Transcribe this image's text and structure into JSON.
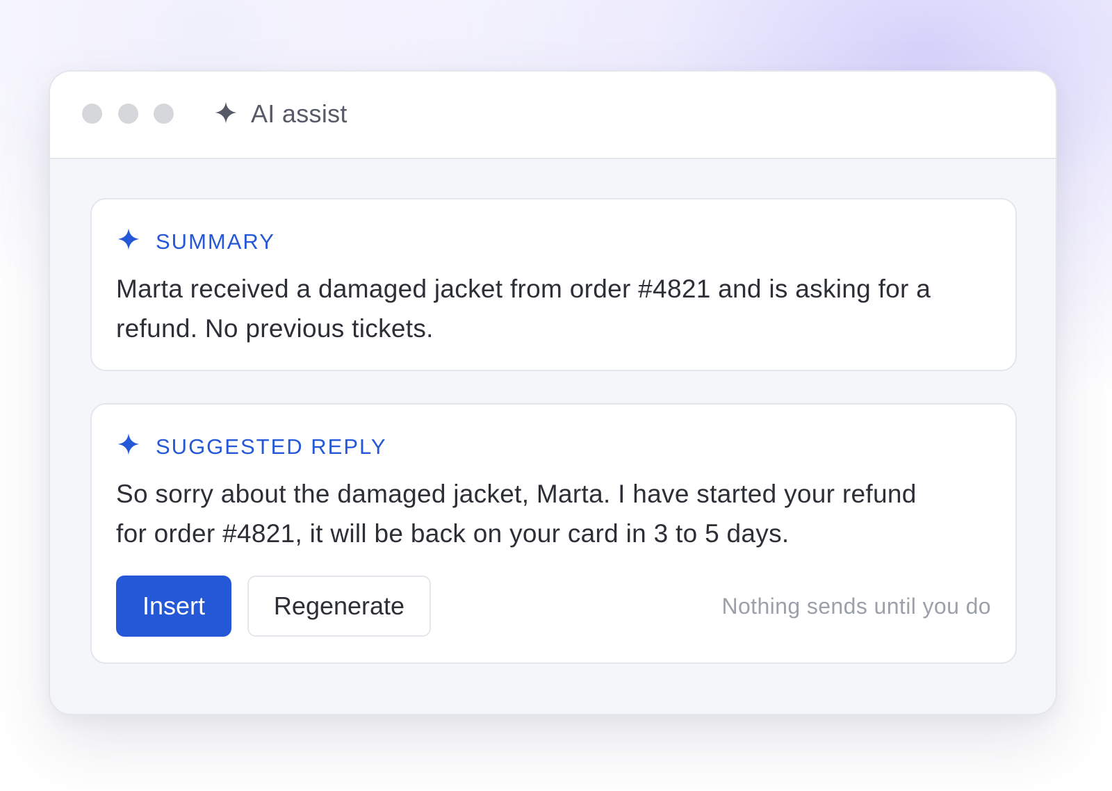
{
  "window": {
    "title": "AI assist",
    "title_icon": "sparkle-icon",
    "traffic_lights": [
      "close",
      "minimize",
      "maximize"
    ]
  },
  "summary_card": {
    "icon": "sparkle-icon",
    "label": "SUMMARY",
    "body": "Marta received a damaged jacket from order #4821 and is asking for a refund. No previous tickets."
  },
  "reply_card": {
    "icon": "sparkle-icon",
    "label": "SUGGESTED REPLY",
    "body": "So sorry about the damaged jacket, Marta. I have started your refund for order #4821, it will be back on your card in 3 to 5 days.",
    "insert_label": "Insert",
    "regenerate_label": "Regenerate",
    "footnote": "Nothing sends until you do"
  },
  "colors": {
    "accent": "#2458d6",
    "body_text": "#2c2f36",
    "muted_text": "#9ba0aa",
    "panel_bg": "#f4f6fa",
    "border": "#e3e6ec"
  }
}
